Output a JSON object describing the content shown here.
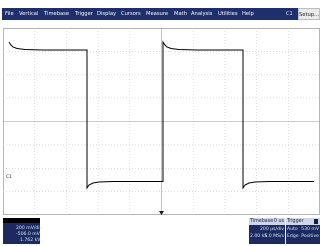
{
  "menu": {
    "items": [
      "File",
      "Vertical",
      "Timebase",
      "Trigger",
      "Display",
      "Cursors",
      "Measure",
      "Math",
      "Analysis",
      "Utilities",
      "Help"
    ],
    "channel_label": "C1",
    "setup_label": "Setup..."
  },
  "channel": {
    "label": "C1",
    "volts_per_div": "200 mV/div",
    "offset": "-506.0 mV",
    "ch_value": "1.762 kV"
  },
  "timebase": {
    "header": "Timebase",
    "header_value": "0 us",
    "time_per_div": "200 µs/div",
    "memory": "2.00 kS",
    "sample_rate": "1.0 MS/s"
  },
  "trigger": {
    "header": "Trigger",
    "mode": "Auto",
    "type": "Edge",
    "level": "530 mV",
    "slope": "Positive"
  },
  "colors": {
    "menu_bg": "#1f2f6c",
    "panel_bg": "#1c2a5f",
    "trace": "#000000",
    "grid": "#c8c8c8"
  }
}
